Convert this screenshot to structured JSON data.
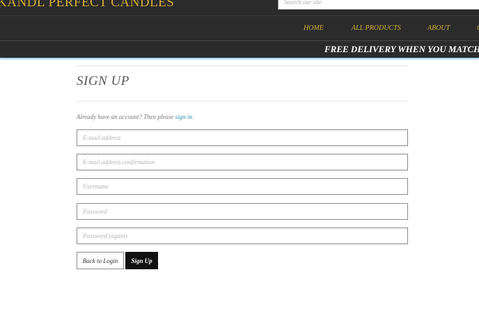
{
  "header": {
    "brand": "KANDL PERFECT CANDLES",
    "search_placeholder": "Search our site"
  },
  "nav": {
    "items": [
      "HOME",
      "ALL PRODUCTS",
      "ABOUT",
      "C"
    ]
  },
  "promo": {
    "text": "FREE DELIVERY WHEN YOU MATCH"
  },
  "main": {
    "title": "SIGN UP",
    "account_prefix": "Already have an account? Then please ",
    "signin_link": "sign in",
    "account_suffix": ".",
    "fields": {
      "email": "E-mail address",
      "email_confirm": "E-mail address confirmation",
      "username": "Username",
      "password": "Password",
      "password_again": "Password (again)"
    },
    "buttons": {
      "back": "Back to Login",
      "signup": "Sign Up"
    }
  },
  "colors": {
    "header_bg": "#2b2b2b",
    "brand_gold": "#d4af37",
    "link": "#2a8fb5"
  }
}
